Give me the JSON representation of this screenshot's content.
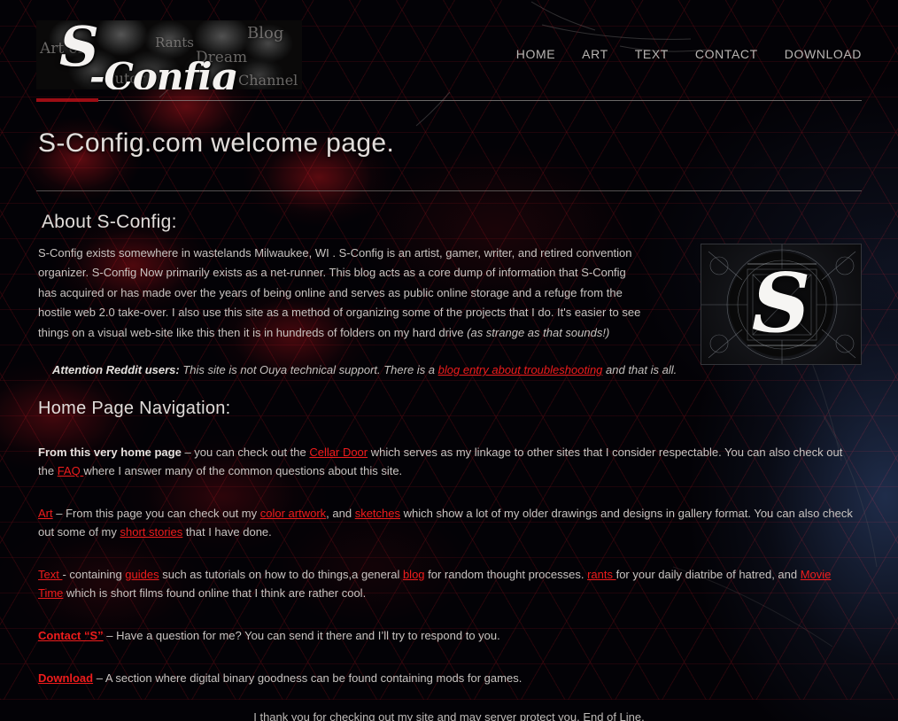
{
  "site": {
    "logo": {
      "alt": "Art of: S-Config",
      "wordmark_s": "S",
      "wordmark_rest": "-Config",
      "ghost_words": {
        "artof": "Art of:",
        "rants": "Rants",
        "blog": "Blog",
        "dream": "Dream",
        "tutor": "Tutor",
        "channel": "Channel"
      }
    },
    "nav": [
      {
        "label": "HOME"
      },
      {
        "label": "ART"
      },
      {
        "label": "TEXT"
      },
      {
        "label": "CONTACT"
      },
      {
        "label": "DOWNLOAD"
      }
    ],
    "accent_color": "#cf1119",
    "link_color": "#ef1c1c"
  },
  "page": {
    "title": "S-Config.com welcome page."
  },
  "about": {
    "heading": "About S-Config:",
    "paragraph_1": "S-Config exists somewhere in wastelands Milwaukee, WI . S-Config is an artist, gamer, writer, and retired convention organizer. S-Config Now primarily exists as a net-runner. This blog acts as a core dump of information that S-Config has acquired or has made over the years of being online and serves as public online storage and a refuge from the hostile web 2.0 take-over. I also use this site as a method of organizing some of the projects that I do. It's easier to see things on a visual web-site like this then it is in hundreds of folders on my hard drive ",
    "paragraph_1_italic_tail": "(as strange as that sounds!)",
    "figure_alt": "S-Config monogram logo",
    "figure_monogram": "S",
    "reddit_note": {
      "lead": "Attention Reddit users:",
      "text_before": " This site is not Ouya technical support. There is a ",
      "link": "blog entry about troubleshooting",
      "text_after": " and that is all."
    }
  },
  "navigation_section": {
    "heading": "Home Page Navigation:",
    "paragraphs": [
      {
        "id": "home-page",
        "lead_bold": "From this very home page",
        "segments": [
          {
            "type": "text",
            "value": " – you can check out the "
          },
          {
            "type": "link",
            "value": "Cellar Door"
          },
          {
            "type": "text",
            "value": " which serves as my linkage to other sites that I consider respectable. You can also check out the "
          },
          {
            "type": "link",
            "value": "FAQ "
          },
          {
            "type": "text",
            "value": "where I answer many of the common questions about this site."
          }
        ]
      },
      {
        "id": "art",
        "segments": [
          {
            "type": "link",
            "value": "Art"
          },
          {
            "type": "text",
            "value": " – From this page you can check out my "
          },
          {
            "type": "link",
            "value": "color artwork"
          },
          {
            "type": "text",
            "value": ", and "
          },
          {
            "type": "link",
            "value": "sketches"
          },
          {
            "type": "text",
            "value": " which show a lot of my older drawings and designs in gallery format. You can also check out some of my "
          },
          {
            "type": "link",
            "value": "short stories"
          },
          {
            "type": "text",
            "value": " that I have done."
          }
        ]
      },
      {
        "id": "text",
        "segments": [
          {
            "type": "link",
            "value": "Text "
          },
          {
            "type": "text",
            "value": "- containing "
          },
          {
            "type": "link",
            "value": "guides"
          },
          {
            "type": "text",
            "value": " such as tutorials on how to do things,a general "
          },
          {
            "type": "link",
            "value": "blog"
          },
          {
            "type": "text",
            "value": " for random thought processes. "
          },
          {
            "type": "link",
            "value": "rants "
          },
          {
            "type": "text",
            "value": "for your daily diatribe of hatred, and "
          },
          {
            "type": "link",
            "value": "Movie Time"
          },
          {
            "type": "text",
            "value": " which is short films found online that I think are rather cool."
          }
        ]
      },
      {
        "id": "contact",
        "segments": [
          {
            "type": "link-bold",
            "value": "Contact “S”"
          },
          {
            "type": "text",
            "value": " – Have a question for me? You can send it there and I’ll try to respond to you."
          }
        ]
      },
      {
        "id": "download",
        "segments": [
          {
            "type": "link-bold",
            "value": "Download"
          },
          {
            "type": "text",
            "value": " – A section where digital binary goodness can be found containing mods for games."
          }
        ]
      }
    ]
  },
  "footer": {
    "text": "I thank you for checking out my site and may server protect you. End of Line."
  }
}
